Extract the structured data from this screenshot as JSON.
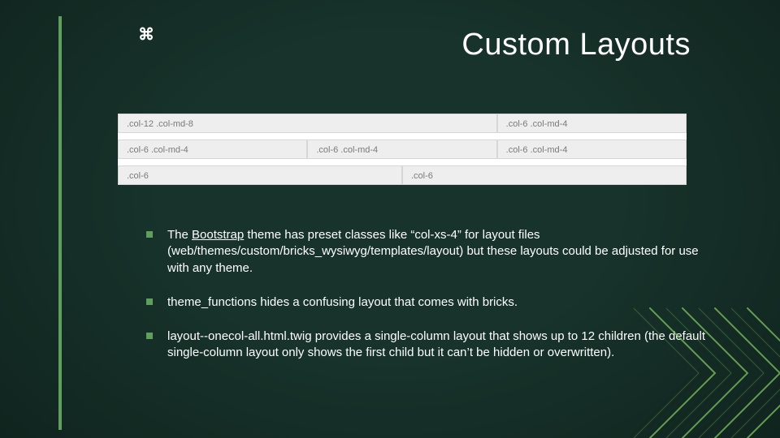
{
  "mark": "⌘",
  "title": "Custom Layouts",
  "grid": {
    "row1": {
      "a": ".col-12 .col-md-8",
      "b": ".col-6 .col-md-4"
    },
    "row2": {
      "a": ".col-6 .col-md-4",
      "b": ".col-6 .col-md-4",
      "c": ".col-6 .col-md-4"
    },
    "row3": {
      "a": ".col-6",
      "b": ".col-6"
    }
  },
  "bullets": {
    "b1_pre": "The ",
    "b1_link": "Bootstrap",
    "b1_post": " theme has preset classes like “col-xs-4” for layout files (web/themes/custom/bricks_wysiwyg/templates/layout) but these layouts could be adjusted for use with any theme.",
    "b2": "theme_functions hides a confusing layout that comes with bricks.",
    "b3": "layout--onecol-all.html.twig provides a single-column layout that shows up to 12 children (the default single-column layout only shows the first child but it can’t be hidden or overwritten)."
  }
}
